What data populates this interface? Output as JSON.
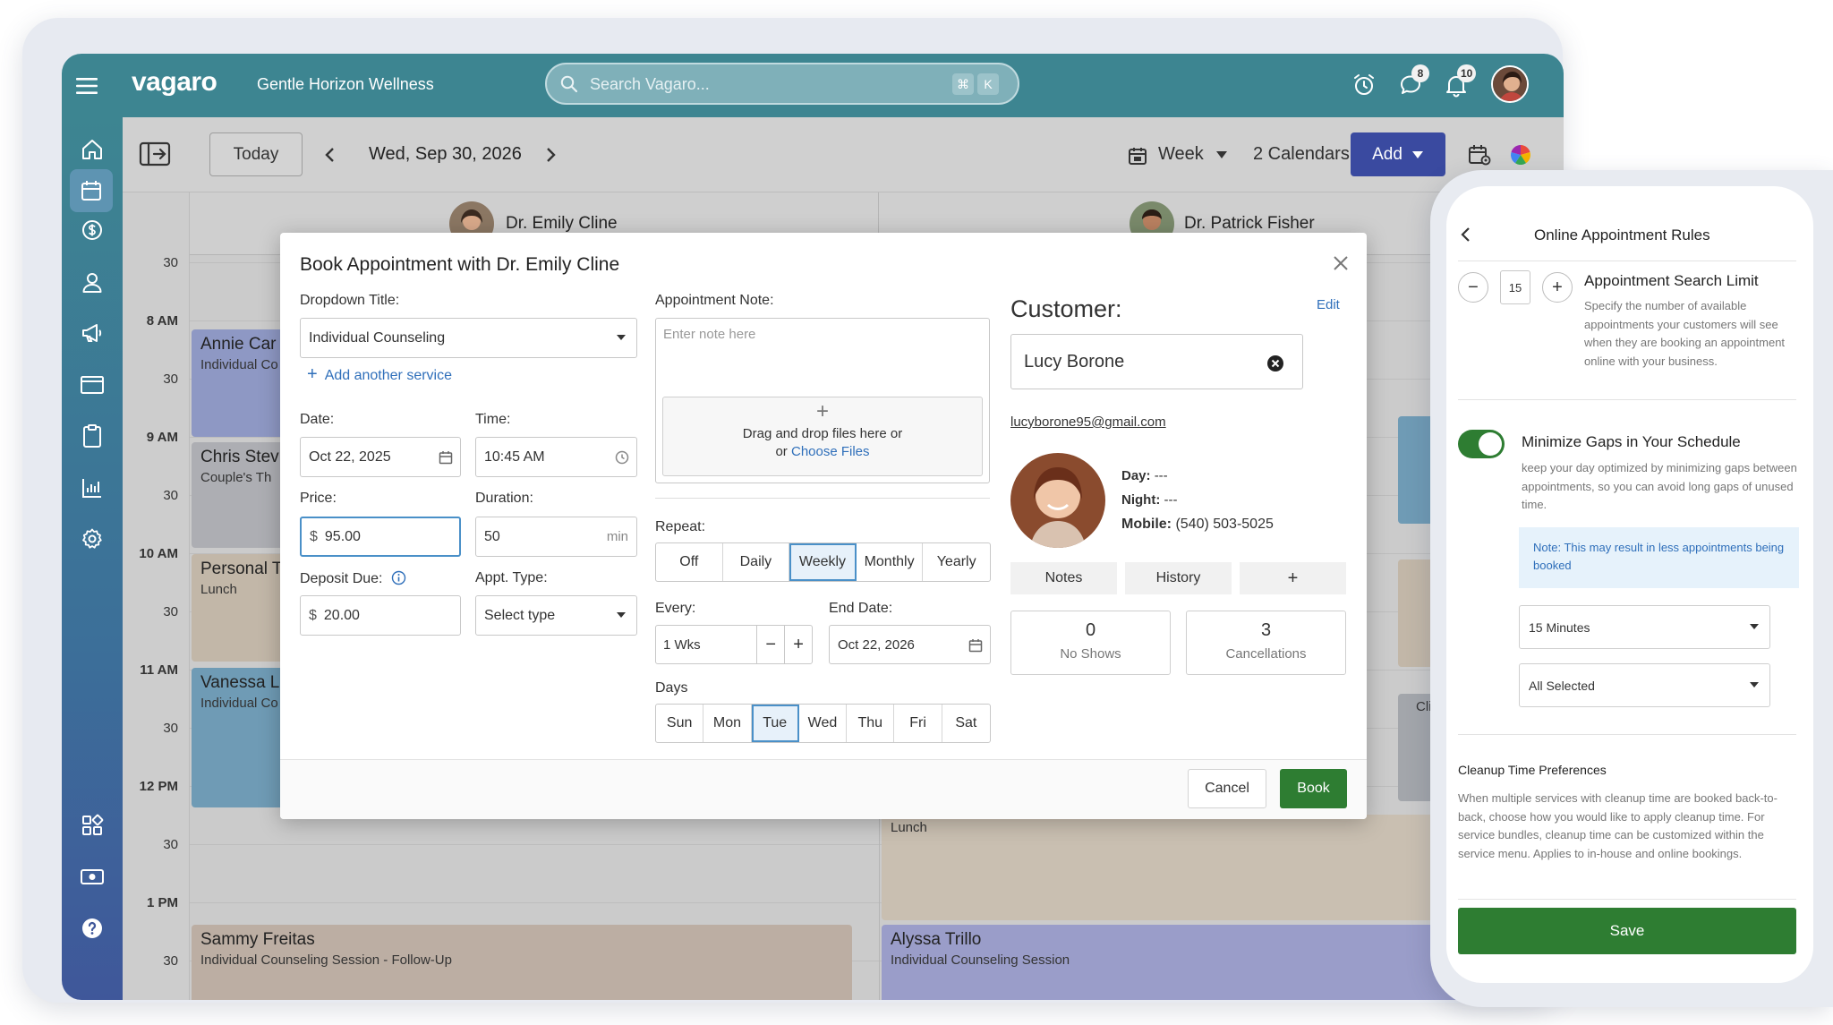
{
  "app": {
    "logo": "vagaro",
    "business": "Gentle Horizon Wellness",
    "search_placeholder": "Search Vagaro...",
    "shortcut_keys": [
      "⌘",
      "K"
    ],
    "messages_badge": "8",
    "notifications_badge": "10"
  },
  "toolbar": {
    "today": "Today",
    "date": "Wed, Sep 30, 2026",
    "view": "Week",
    "calendars": "2 Calendars",
    "add": "Add"
  },
  "providers": [
    "Dr. Emily Cline",
    "Dr. Patrick Fisher"
  ],
  "time_labels": [
    {
      "text": "30",
      "bold": false
    },
    {
      "text": "8 AM",
      "bold": true
    },
    {
      "text": "30",
      "bold": false
    },
    {
      "text": "9 AM",
      "bold": true
    },
    {
      "text": "30",
      "bold": false
    },
    {
      "text": "10 AM",
      "bold": true
    },
    {
      "text": "30",
      "bold": false
    },
    {
      "text": "11 AM",
      "bold": true
    },
    {
      "text": "30",
      "bold": false
    },
    {
      "text": "12 PM",
      "bold": true
    },
    {
      "text": "30",
      "bold": false
    },
    {
      "text": "1 PM",
      "bold": true
    },
    {
      "text": "30",
      "bold": false
    }
  ],
  "appointments": [
    {
      "name": "Annie Car",
      "service": "Individual Co",
      "color": "#8e98c4"
    },
    {
      "name": "Chris Stev",
      "service": "Couple's Th",
      "color": "#adaeb3"
    },
    {
      "name": "Personal T",
      "service": "Lunch",
      "color": "#c2b7a8"
    },
    {
      "name": "Vanessa L",
      "service": "Individual Co",
      "color": "#6f9bb5"
    },
    {
      "name": "Sammy Freitas",
      "service": "Individual Counseling Session - Follow-Up",
      "color": "#bcaea3"
    },
    {
      "name": "Alyssa Trillo",
      "service": "Individual Counseling Session",
      "color": "#9a9dc9"
    },
    {
      "name": "",
      "service": "Lunch",
      "color": "#c9bfb1"
    },
    {
      "name": "",
      "service": "Client",
      "color": "#a3a6ab"
    }
  ],
  "modal": {
    "title": "Book Appointment with Dr. Emily Cline",
    "dropdown_title_label": "Dropdown Title:",
    "service": "Individual Counseling",
    "add_service": "Add another service",
    "date_label": "Date:",
    "date": "Oct 22, 2025",
    "time_label": "Time:",
    "time": "10:45 AM",
    "price_label": "Price:",
    "price_prefix": "$",
    "price": "95.00",
    "duration_label": "Duration:",
    "duration": "50",
    "duration_unit": "min",
    "deposit_label": "Deposit Due:",
    "deposit_prefix": "$",
    "deposit": "20.00",
    "appt_type_label": "Appt. Type:",
    "appt_type_placeholder": "Select type",
    "note_label": "Appointment Note:",
    "note_placeholder": "Enter note here",
    "upload_text": "Drag and drop files here or",
    "upload_or": "or",
    "upload_link": "Choose Files",
    "repeat_label": "Repeat:",
    "repeat_options": [
      "Off",
      "Daily",
      "Weekly",
      "Monthly",
      "Yearly"
    ],
    "repeat_selected": "Weekly",
    "every_label": "Every:",
    "every_value": "1 Wks",
    "end_date_label": "End Date:",
    "end_date": "Oct 22, 2026",
    "days_label": "Days",
    "days": [
      "Sun",
      "Mon",
      "Tue",
      "Wed",
      "Thu",
      "Fri",
      "Sat"
    ],
    "days_selected": "Tue",
    "cancel": "Cancel",
    "book": "Book"
  },
  "customer": {
    "heading": "Customer:",
    "edit": "Edit",
    "name": "Lucy Borone",
    "email": "lucyborone95@gmail.com",
    "day_label": "Day:",
    "day_value": "---",
    "night_label": "Night:",
    "night_value": "---",
    "mobile_label": "Mobile:",
    "mobile_value": "(540) 503-5025",
    "tabs": [
      "Notes",
      "History",
      "+"
    ],
    "no_shows_value": "0",
    "no_shows_label": "No Shows",
    "cancellations_value": "3",
    "cancellations_label": "Cancellations"
  },
  "phone": {
    "title": "Online Appointment Rules",
    "limit_value": "15",
    "limit_title": "Appointment Search Limit",
    "limit_desc": "Specify the number of available appointments your customers will see when they are booking an appointment online with your business.",
    "gaps_title": "Minimize Gaps in Your Schedule",
    "gaps_desc": "keep your day optimized by minimizing gaps between appointments, so you can avoid long gaps of unused time.",
    "gaps_enabled": true,
    "note_label": "Note:",
    "note_text": "This may result in less appointments being booked",
    "select1": "15 Minutes",
    "select2": "All Selected",
    "cleanup_title": "Cleanup Time Preferences",
    "cleanup_desc": "When multiple services with cleanup time are booked back-to-back, choose how you would like to apply cleanup time. For service bundles, cleanup time can be customized within the service menu. Applies to in-house and online bookings.",
    "save": "Save",
    "accent": "#2e7d32"
  }
}
